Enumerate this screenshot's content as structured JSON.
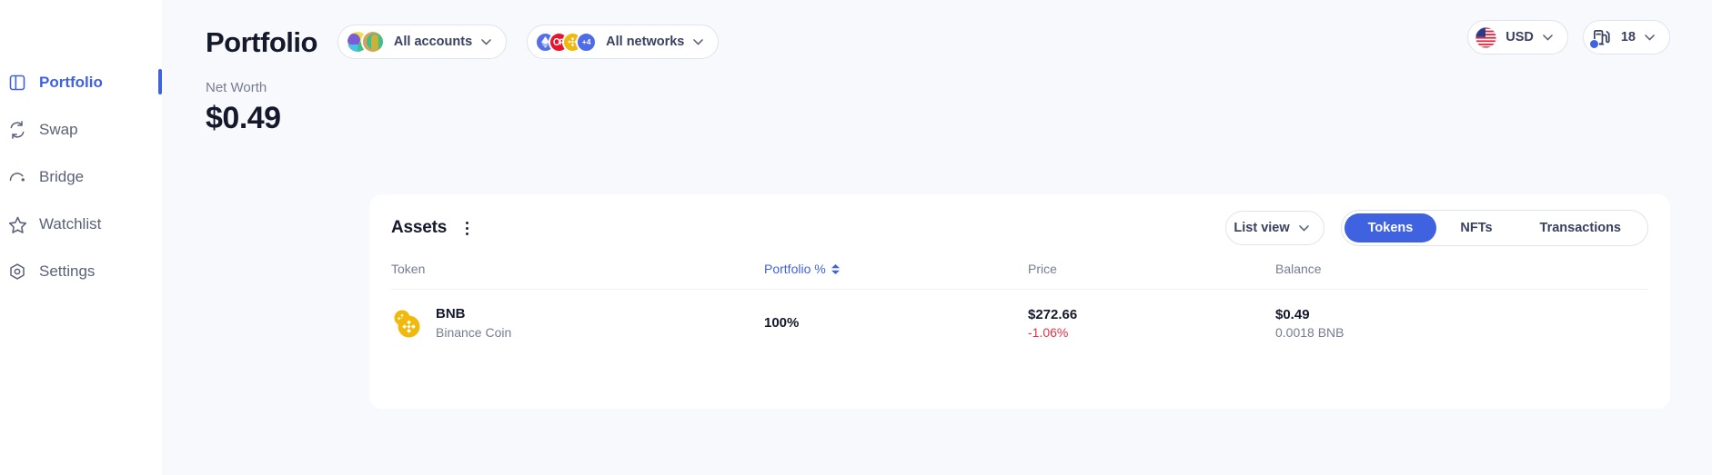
{
  "sidebar": {
    "items": [
      {
        "label": "Portfolio",
        "icon": "layout-panel-icon",
        "active": true
      },
      {
        "label": "Swap",
        "icon": "swap-arrows-icon",
        "active": false
      },
      {
        "label": "Bridge",
        "icon": "bridge-arc-icon",
        "active": false
      },
      {
        "label": "Watchlist",
        "icon": "star-icon",
        "active": false
      },
      {
        "label": "Settings",
        "icon": "settings-gear-icon",
        "active": false
      }
    ]
  },
  "header": {
    "title": "Portfolio",
    "accounts_filter": {
      "label": "All accounts",
      "icon": "chevron-down-icon"
    },
    "networks_filter": {
      "label": "All networks",
      "icon": "chevron-down-icon",
      "extra_count": "+4"
    },
    "currency": {
      "label": "USD",
      "icon": "us-flag-icon"
    },
    "gas": {
      "label": "18",
      "icon": "gas-pump-icon"
    }
  },
  "net_worth": {
    "label": "Net Worth",
    "value": "$0.49"
  },
  "assets": {
    "title": "Assets",
    "menu_icon": "kebab-menu-icon",
    "view_selector": {
      "label": "List view",
      "icon": "chevron-down-icon"
    },
    "tabs": [
      {
        "label": "Tokens",
        "active": true
      },
      {
        "label": "NFTs",
        "active": false
      },
      {
        "label": "Transactions",
        "active": false
      }
    ],
    "columns": [
      {
        "label": "Token",
        "sorted": false
      },
      {
        "label": "Portfolio %",
        "sorted": true
      },
      {
        "label": "Price",
        "sorted": false
      },
      {
        "label": "Balance",
        "sorted": false
      }
    ],
    "rows": [
      {
        "symbol": "BNB",
        "name": "Binance Coin",
        "logo": "bnb-token-icon",
        "portfolio_pct": "100%",
        "price": "$272.66",
        "price_change": "-1.06%",
        "balance_usd": "$0.49",
        "balance_qty": "0.0018 BNB"
      }
    ]
  },
  "colors": {
    "accent": "#3f62e0",
    "negative": "#e8304a",
    "page_bg": "#f8f9fc",
    "card_bg": "#ffffff",
    "text": "#15192c",
    "muted": "#767c94"
  }
}
